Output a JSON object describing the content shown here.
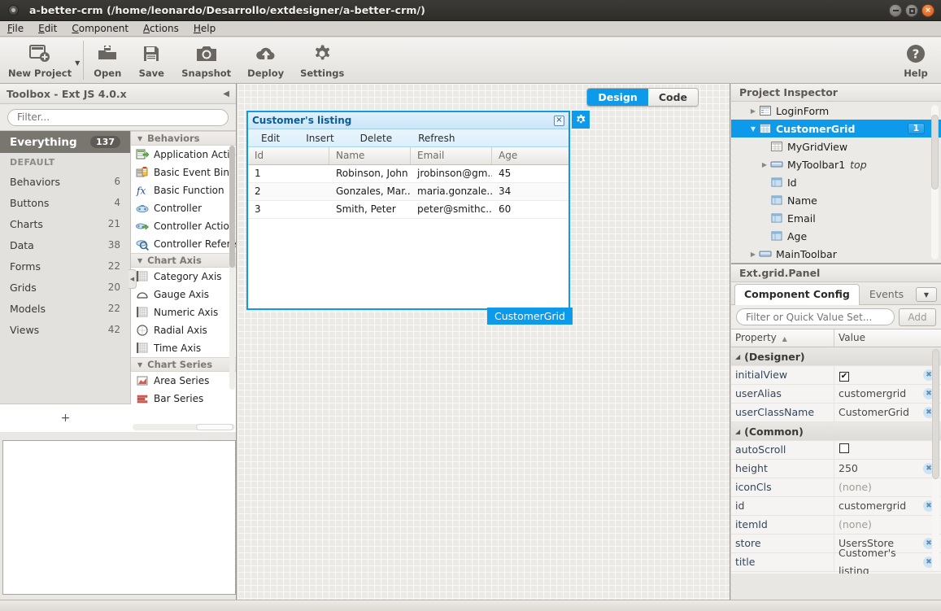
{
  "window": {
    "title": "a-better-crm (/home/leonardo/Desarrollo/extdesigner/a-better-crm/)",
    "minimize_label": "–",
    "maximize_label": "□",
    "close_label": "×"
  },
  "menubar": {
    "items": [
      {
        "acc": "F",
        "rest": "ile"
      },
      {
        "acc": "E",
        "rest": "dit"
      },
      {
        "acc": "C",
        "rest": "omponent"
      },
      {
        "acc": "A",
        "rest": "ctions"
      },
      {
        "acc": "H",
        "rest": "elp"
      }
    ]
  },
  "toolbar": {
    "new_project": "New Project",
    "open": "Open",
    "save": "Save",
    "snapshot": "Snapshot",
    "deploy": "Deploy",
    "settings": "Settings",
    "help": "Help",
    "dropdown_caret": "▼"
  },
  "toolbox": {
    "title": "Toolbox - Ext JS 4.0.x",
    "collapse_icon": "◀",
    "filter_placeholder": "Filter...",
    "add_label": "+",
    "categories": [
      {
        "label": "Everything",
        "count": "137",
        "active": true
      },
      {
        "label": "DEFAULT",
        "count": "",
        "section": true
      },
      {
        "label": "Behaviors",
        "count": "6"
      },
      {
        "label": "Buttons",
        "count": "4"
      },
      {
        "label": "Charts",
        "count": "21"
      },
      {
        "label": "Data",
        "count": "38"
      },
      {
        "label": "Forms",
        "count": "22"
      },
      {
        "label": "Grids",
        "count": "20"
      },
      {
        "label": "Models",
        "count": "22"
      },
      {
        "label": "Views",
        "count": "42"
      }
    ],
    "groups": [
      {
        "label": "Behaviors",
        "tri": "▼",
        "items": [
          {
            "label": "Application Action",
            "icon": "application-action-icon"
          },
          {
            "label": "Basic Event Binding",
            "icon": "basic-event-binding-icon"
          },
          {
            "label": "Basic Function",
            "icon": "basic-function-icon"
          },
          {
            "label": "Controller",
            "icon": "controller-icon"
          },
          {
            "label": "Controller Action",
            "icon": "controller-action-icon"
          },
          {
            "label": "Controller Reference",
            "icon": "controller-reference-icon"
          }
        ]
      },
      {
        "label": "Chart Axis",
        "tri": "▼",
        "items": [
          {
            "label": "Category Axis",
            "icon": "category-axis-icon"
          },
          {
            "label": "Gauge Axis",
            "icon": "gauge-axis-icon"
          },
          {
            "label": "Numeric Axis",
            "icon": "numeric-axis-icon"
          },
          {
            "label": "Radial Axis",
            "icon": "radial-axis-icon"
          },
          {
            "label": "Time Axis",
            "icon": "time-axis-icon"
          }
        ]
      },
      {
        "label": "Chart Series",
        "tri": "▼",
        "items": [
          {
            "label": "Area Series",
            "icon": "area-series-icon"
          },
          {
            "label": "Bar Series",
            "icon": "bar-series-icon"
          }
        ]
      }
    ],
    "splitter_icon": "◀"
  },
  "canvas": {
    "view_design": "Design",
    "view_code": "Code",
    "active_view": "Design",
    "component_badge": "CustomerGrid",
    "gear_icon": "⚙"
  },
  "grid_panel": {
    "title": "Customer's listing",
    "close_icon": "×",
    "toolbar_buttons": [
      "Edit",
      "Insert",
      "Delete",
      "Refresh"
    ],
    "columns": [
      "Id",
      "Name",
      "Email",
      "Age"
    ],
    "rows": [
      [
        "1",
        "Robinson, John",
        "jrobinson@gm...",
        "45"
      ],
      [
        "2",
        "Gonzales, Mar...",
        "maria.gonzale...",
        "34"
      ],
      [
        "3",
        "Smith, Peter",
        "peter@smithc...",
        "60"
      ]
    ]
  },
  "project_inspector": {
    "title": "Project Inspector",
    "nodes": [
      {
        "label": "LoginForm",
        "indent": 1,
        "arrow": "▶",
        "icon": "form-icon",
        "selected": false
      },
      {
        "label": "CustomerGrid",
        "indent": 1,
        "arrow": "▼",
        "icon": "grid-icon",
        "selected": true,
        "badge": "1"
      },
      {
        "label": "MyGridView",
        "indent": 2,
        "arrow": "",
        "icon": "gridview-icon",
        "selected": false
      },
      {
        "label": "MyToolbar1",
        "indent": 2,
        "arrow": "▶",
        "icon": "toolbar-icon",
        "selected": false,
        "suffix": "top"
      },
      {
        "label": "Id",
        "indent": 2,
        "arrow": "",
        "icon": "column-icon",
        "selected": false
      },
      {
        "label": "Name",
        "indent": 2,
        "arrow": "",
        "icon": "column-icon",
        "selected": false
      },
      {
        "label": "Email",
        "indent": 2,
        "arrow": "",
        "icon": "column-icon",
        "selected": false
      },
      {
        "label": "Age",
        "indent": 2,
        "arrow": "",
        "icon": "column-icon",
        "selected": false
      },
      {
        "label": "MainToolbar",
        "indent": 1,
        "arrow": "▶",
        "icon": "toolbar-icon",
        "selected": false
      }
    ]
  },
  "component_config": {
    "title": "Ext.grid.Panel",
    "tabs": [
      {
        "label": "Component Config",
        "active": true
      },
      {
        "label": "Events",
        "active": false
      }
    ],
    "tab_menu_icon": "▼",
    "filter_placeholder": "Filter or Quick Value Set...",
    "add_label": "Add",
    "col_property": "Property",
    "col_property_sort": "▲",
    "col_value": "Value",
    "clear_icon": "✖",
    "rows": [
      {
        "type": "group",
        "label": "(Designer)",
        "tri": "◢"
      },
      {
        "type": "prop",
        "name": "initialView",
        "value": "",
        "control": "checkbox-checked",
        "clear": true
      },
      {
        "type": "prop",
        "name": "userAlias",
        "value": "customergrid",
        "clear": true
      },
      {
        "type": "prop",
        "name": "userClassName",
        "value": "CustomerGrid",
        "clear": true
      },
      {
        "type": "group",
        "label": "(Common)",
        "tri": "◢"
      },
      {
        "type": "prop",
        "name": "autoScroll",
        "value": "",
        "control": "checkbox-unchecked",
        "clear": false
      },
      {
        "type": "prop",
        "name": "height",
        "value": "250",
        "clear": true
      },
      {
        "type": "prop",
        "name": "iconCls",
        "value": "(none)",
        "none": true,
        "clear": false
      },
      {
        "type": "prop",
        "name": "id",
        "value": "customergrid",
        "clear": true
      },
      {
        "type": "prop",
        "name": "itemId",
        "value": "(none)",
        "none": true,
        "clear": false
      },
      {
        "type": "prop",
        "name": "store",
        "value": "UsersStore",
        "clear": true
      },
      {
        "type": "prop",
        "name": "title",
        "value": "Customer's listing",
        "clear": true
      }
    ]
  },
  "colors": {
    "accent": "#0e9aeb",
    "title_bar": "#2e2d2a",
    "close_button": "#d8551b",
    "panel_bg": "#e9e7e4",
    "active_category": "#79766f"
  }
}
